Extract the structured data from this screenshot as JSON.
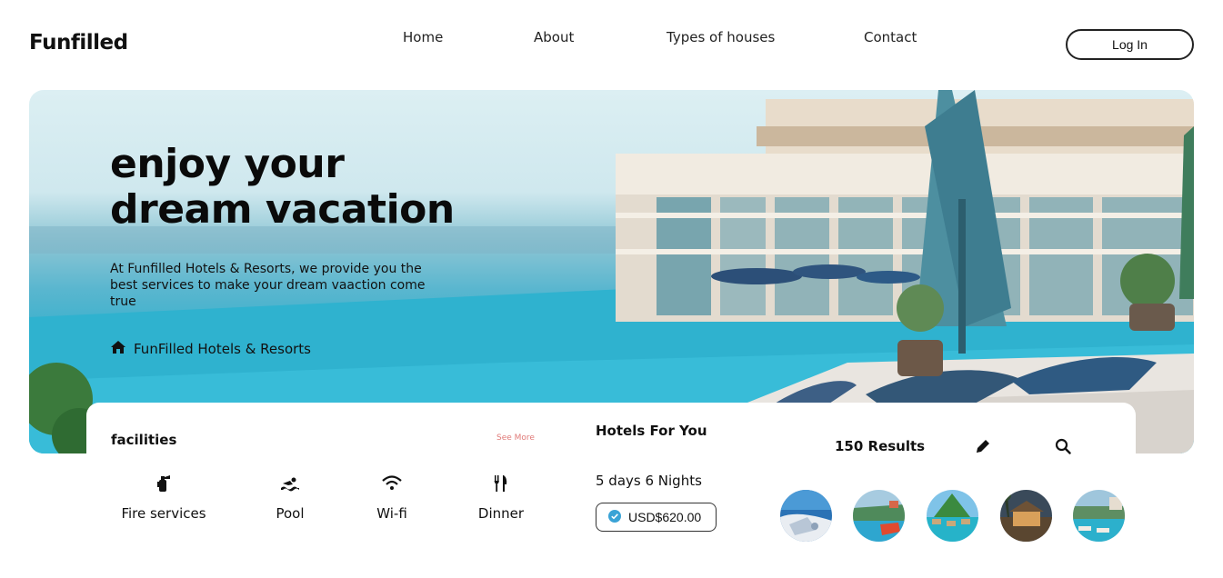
{
  "brand": {
    "logo": "Funfilled"
  },
  "nav": {
    "items": [
      "Home",
      "About",
      "Types of houses",
      "Contact"
    ],
    "login_label": "Log In"
  },
  "hero": {
    "title": "enjoy your dream vacation",
    "description": "At Funfilled Hotels & Resorts, we provide you the best services to make your dream vaaction come true",
    "brand_line": "FunFilled Hotels & Resorts",
    "brand_icon": "home-icon"
  },
  "facilities": {
    "title": "facilities",
    "see_more": "See More",
    "items": [
      {
        "label": "Fire services",
        "icon": "fire-extinguisher-icon"
      },
      {
        "label": "Pool",
        "icon": "swimmer-icon"
      },
      {
        "label": "Wi-fi",
        "icon": "wifi-icon"
      },
      {
        "label": "Dinner",
        "icon": "utensils-icon"
      }
    ]
  },
  "hotels": {
    "title": "Hotels For You",
    "duration": "5 days 6 Nights",
    "price": "USD$620.00",
    "price_icon": "check-circle-icon",
    "results": "150 Results",
    "thumbnails": [
      "hotel-thumb-1",
      "hotel-thumb-2",
      "hotel-thumb-3",
      "hotel-thumb-4",
      "hotel-thumb-5"
    ]
  },
  "colors": {
    "accent_check": "#3aa3d6",
    "see_more": "#e07a78",
    "text": "#111111"
  }
}
